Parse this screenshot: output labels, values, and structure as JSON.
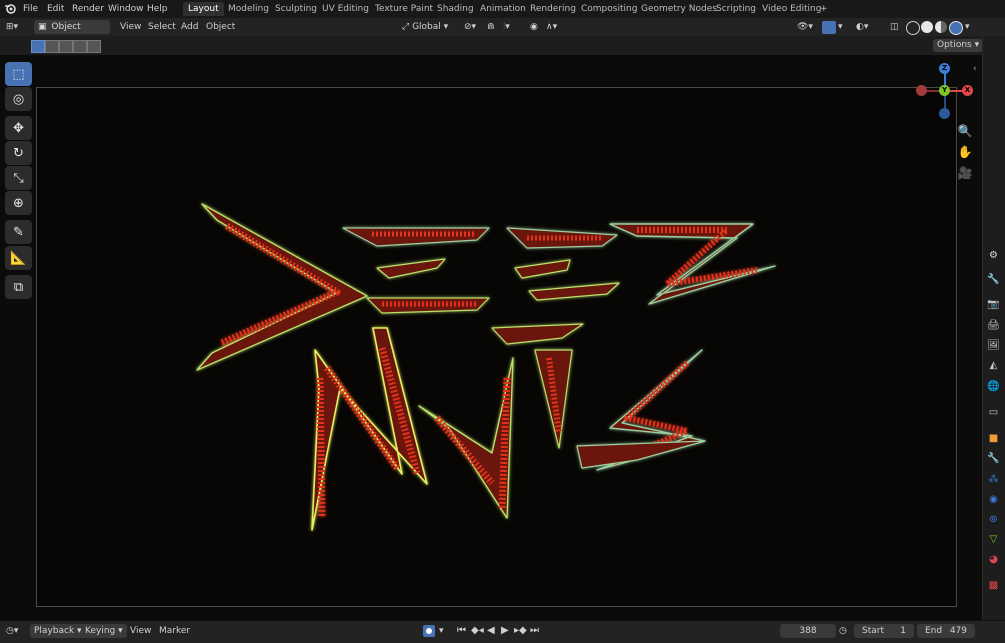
{
  "topbar": {
    "menus": [
      "File",
      "Edit",
      "Render",
      "Window",
      "Help"
    ],
    "workspaces": [
      "Layout",
      "Modeling",
      "Sculpting",
      "UV Editing",
      "Texture Paint",
      "Shading",
      "Animation",
      "Rendering",
      "Compositing",
      "Geometry Nodes",
      "Scripting",
      "Video Editing"
    ],
    "add_tab": "+"
  },
  "header": {
    "mode": "Object Mode",
    "menus": [
      "View",
      "Select",
      "Add",
      "Object"
    ],
    "orientation": "Global",
    "options": "Options"
  },
  "gizmo": {
    "z": "Z",
    "y": "Y",
    "x": "X"
  },
  "timeline": {
    "playback": "Playback",
    "keying": "Keying",
    "view": "View",
    "marker": "Marker",
    "current_frame": "388",
    "start_label": "Start",
    "start_value": "1",
    "end_label": "End",
    "end_value": "479"
  },
  "colors": {
    "accent": "#4772b3",
    "x_axis": "#e0464a",
    "y_axis": "#7cc62a",
    "z_axis": "#3b7cd6",
    "glow_red": "#e0301c",
    "glow_green": "#b8e06a"
  }
}
